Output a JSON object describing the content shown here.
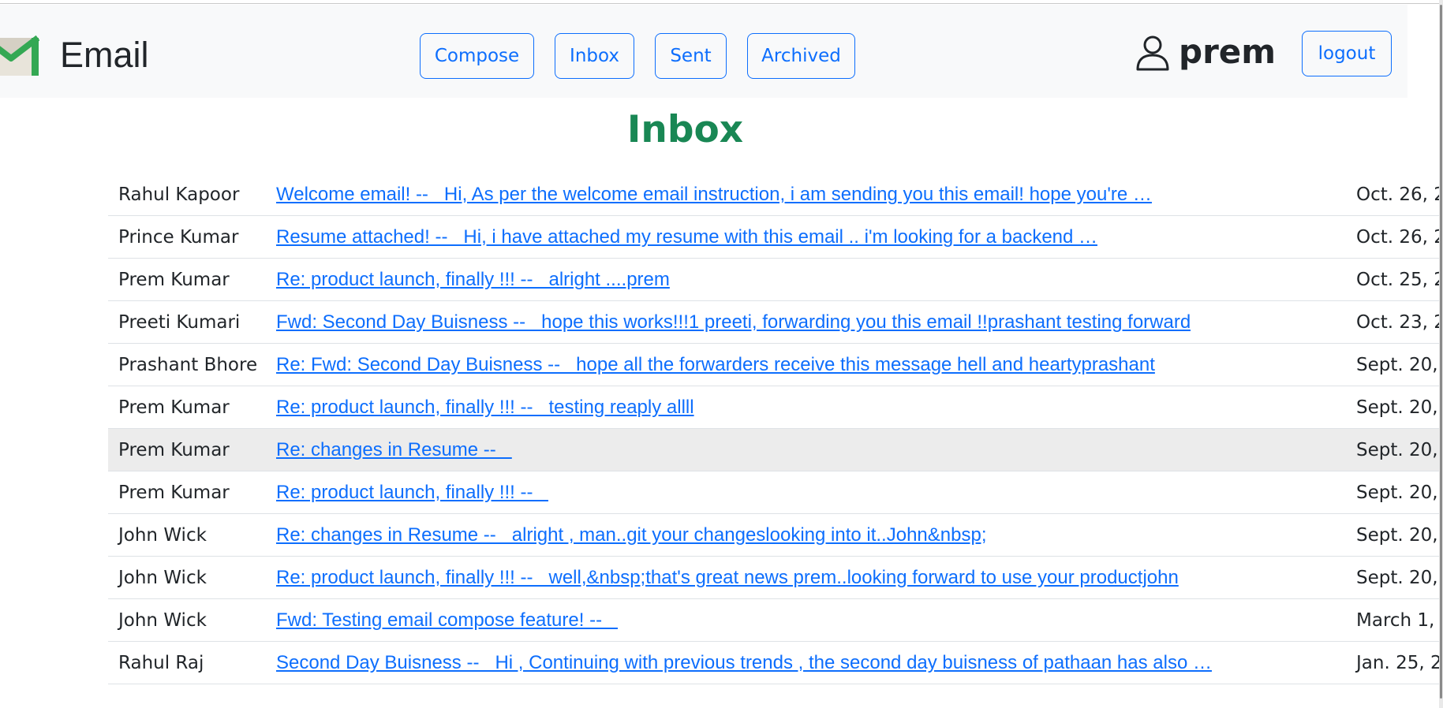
{
  "header": {
    "brand": "Email",
    "nav": [
      {
        "label": "Compose",
        "icon": "compose"
      },
      {
        "label": "Inbox",
        "icon": "inbox"
      },
      {
        "label": "Sent",
        "icon": "sent"
      },
      {
        "label": "Archived",
        "icon": "archived"
      }
    ],
    "username": "prem",
    "logout_label": "logout",
    "colors": {
      "accent": "#0d6efd",
      "navbar_bg": "#f8f9fa",
      "logo_green": "#34a853"
    }
  },
  "main": {
    "title": "Inbox",
    "title_color": "#198754",
    "emails": [
      {
        "sender": "Rahul Kapoor",
        "subject": "Welcome email! --   Hi, As per the welcome email instruction, i am sending you this email! hope you're …",
        "date": "Oct. 26, 2"
      },
      {
        "sender": "Prince Kumar",
        "subject": "Resume attached! --   Hi, i have attached my resume with this email .. i'm looking for a backend …",
        "date": "Oct. 26, 2"
      },
      {
        "sender": "Prem Kumar",
        "subject": "Re: product launch, finally !!! --   alright ....prem",
        "date": "Oct. 25, 2"
      },
      {
        "sender": "Preeti Kumari",
        "subject": "Fwd: Second Day Buisness --   hope this works!!!1 preeti, forwarding you this email !!prashant testing forward",
        "date": "Oct. 23, 2"
      },
      {
        "sender": "Prashant Bhore",
        "subject": "Re: Fwd: Second Day Buisness --   hope all the forwarders receive this message hell and heartyprashant",
        "date": "Sept. 20,"
      },
      {
        "sender": "Prem Kumar",
        "subject": "Re: product launch, finally !!! --   testing reaply allll",
        "date": "Sept. 20,"
      },
      {
        "sender": "Prem Kumar",
        "subject": "Re: changes in Resume --   ",
        "date": "Sept. 20,",
        "highlighted": true
      },
      {
        "sender": "Prem Kumar",
        "subject": "Re: product launch, finally !!! --   ",
        "date": "Sept. 20,"
      },
      {
        "sender": "John Wick",
        "subject": "Re: changes in Resume --   alright , man..git your changeslooking into it..John&nbsp;",
        "date": "Sept. 20,"
      },
      {
        "sender": "John Wick",
        "subject": "Re: product launch, finally !!! --   well,&nbsp;that's great news prem..looking forward to use your productjohn",
        "date": "Sept. 20,"
      },
      {
        "sender": "John Wick",
        "subject": "Fwd: Testing email compose feature! --   ",
        "date": "March 1, :"
      },
      {
        "sender": "Rahul Raj",
        "subject": "Second Day Buisness --   Hi , Continuing with previous trends , the second day buisness of pathaan has also …",
        "date": "Jan. 25, 2"
      }
    ]
  }
}
